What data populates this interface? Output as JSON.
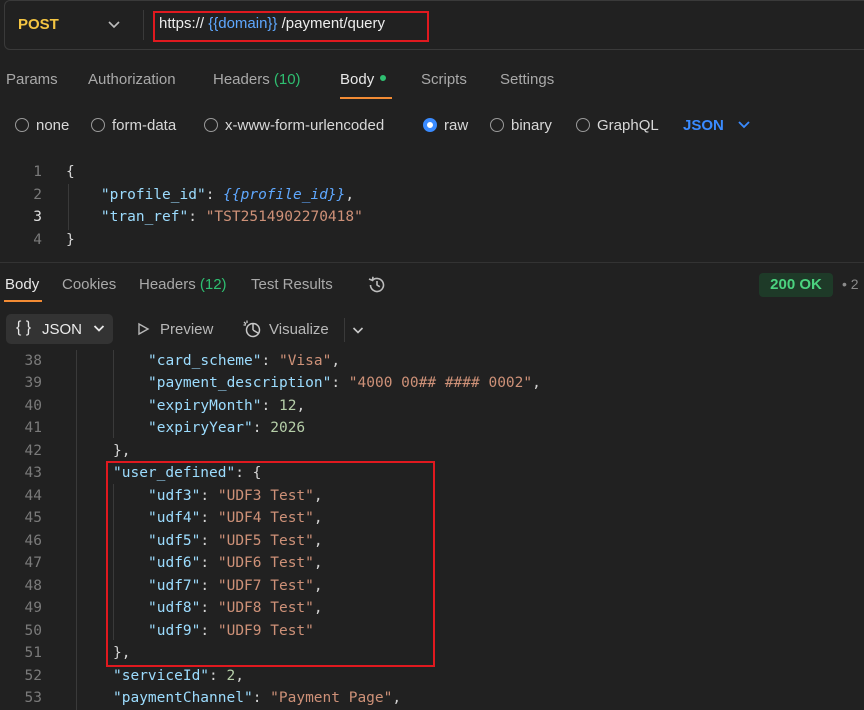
{
  "request": {
    "method": "POST",
    "url_prefix": "https://",
    "url_var": "{{domain}}",
    "url_suffix": "/payment/query"
  },
  "request_tabs": [
    {
      "label": "Params"
    },
    {
      "label": "Authorization"
    },
    {
      "label": "Headers",
      "count": "(10)"
    },
    {
      "label": "Body"
    },
    {
      "label": "Scripts"
    },
    {
      "label": "Settings"
    }
  ],
  "body_types": [
    "none",
    "form-data",
    "x-www-form-urlencoded",
    "raw",
    "binary",
    "GraphQL"
  ],
  "body_type_selected": "raw",
  "raw_format": "JSON",
  "request_body": {
    "line_numbers": [
      "1",
      "2",
      "3",
      "4"
    ],
    "open": "{",
    "close": "}",
    "k1": "\"profile_id\"",
    "v1": "{{profile_id}}",
    "k2": "\"tran_ref\"",
    "v2": "\"TST2514902270418\""
  },
  "response_tabs": [
    {
      "label": "Body"
    },
    {
      "label": "Cookies"
    },
    {
      "label": "Headers",
      "count": "(12)"
    },
    {
      "label": "Test Results"
    }
  ],
  "response_status": "200 OK",
  "response_status_tail": "• 2",
  "response_toolbar": {
    "format": "JSON",
    "preview": "Preview",
    "visualize": "Visualize"
  },
  "response_body": {
    "line_numbers": [
      "38",
      "39",
      "40",
      "41",
      "42",
      "43",
      "44",
      "45",
      "46",
      "47",
      "48",
      "49",
      "50",
      "51",
      "52",
      "53"
    ],
    "card_scheme_k": "\"card_scheme\"",
    "card_scheme_v": "\"Visa\"",
    "payment_description_k": "\"payment_description\"",
    "payment_description_v": "\"4000 00## #### 0002\"",
    "expiryMonth_k": "\"expiryMonth\"",
    "expiryMonth_v": "12",
    "expiryYear_k": "\"expiryYear\"",
    "expiryYear_v": "2026",
    "user_defined_k": "\"user_defined\"",
    "udf3_k": "\"udf3\"",
    "udf3_v": "\"UDF3 Test\"",
    "udf4_k": "\"udf4\"",
    "udf4_v": "\"UDF4 Test\"",
    "udf5_k": "\"udf5\"",
    "udf5_v": "\"UDF5 Test\"",
    "udf6_k": "\"udf6\"",
    "udf6_v": "\"UDF6 Test\"",
    "udf7_k": "\"udf7\"",
    "udf7_v": "\"UDF7 Test\"",
    "udf8_k": "\"udf8\"",
    "udf8_v": "\"UDF8 Test\"",
    "udf9_k": "\"udf9\"",
    "udf9_v": "\"UDF9 Test\"",
    "serviceId_k": "\"serviceId\"",
    "serviceId_v": "2",
    "paymentChannel_k": "\"paymentChannel\"",
    "paymentChannel_v": "\"Payment Page\""
  },
  "colors": {
    "accent": "#f28b34",
    "highlight": "#e0191f",
    "status_ok": "#4bd37f",
    "link_blue": "#3a8bff"
  }
}
